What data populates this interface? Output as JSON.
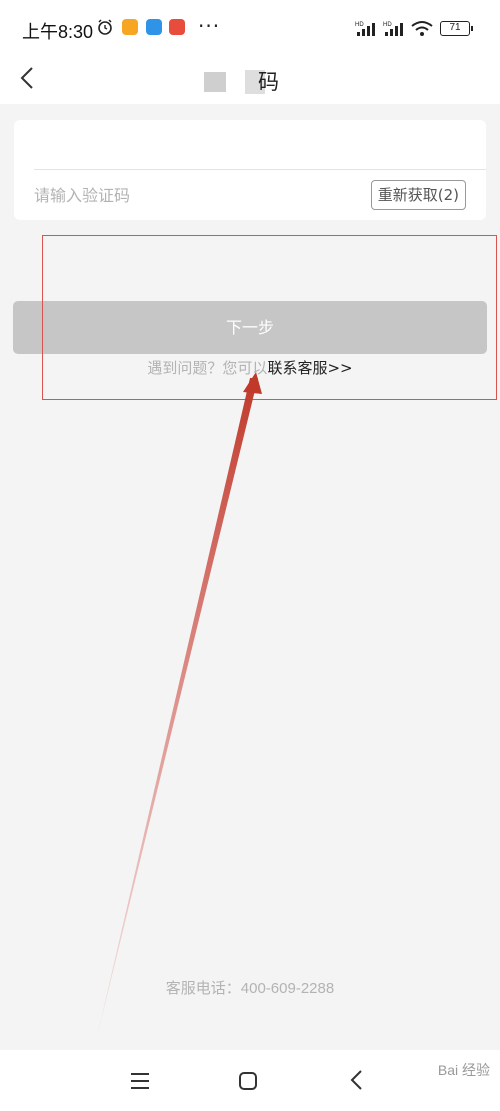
{
  "status_bar": {
    "time": "上午8:30",
    "more": "···",
    "battery": "71"
  },
  "header": {
    "title": "码"
  },
  "form": {
    "code_placeholder": "请输入验证码",
    "resend_label": "重新获取(2)"
  },
  "actions": {
    "next_label": "下一步"
  },
  "help": {
    "text": "遇到问题？您可以",
    "link": "联系客服>>"
  },
  "footer": {
    "service_phone": "客服电话：400-609-2288"
  },
  "watermark": "Bai 经验",
  "colors": {
    "accent_red": "#d9534f",
    "button_disabled": "#c6c6c6",
    "background": "#f4f4f4"
  }
}
